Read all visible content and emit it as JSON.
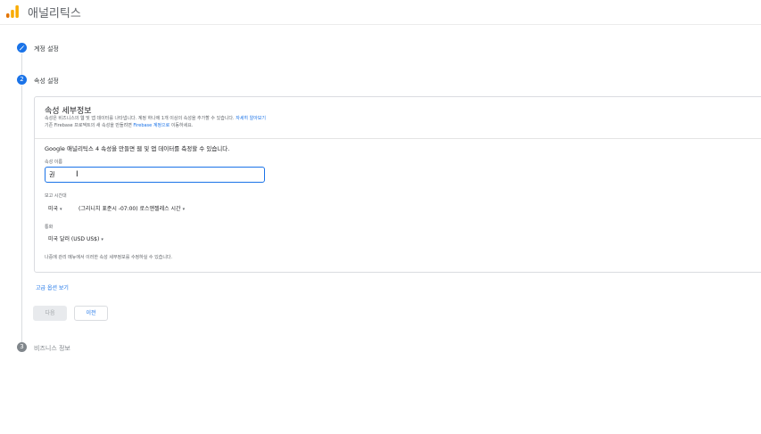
{
  "header": {
    "title": "애널리틱스"
  },
  "steps": [
    {
      "number": "1",
      "label": "계정 설정",
      "state": "done"
    },
    {
      "number": "2",
      "label": "속성 설정",
      "state": "active"
    },
    {
      "number": "3",
      "label": "비즈니스 정보",
      "state": "pending"
    }
  ],
  "card": {
    "title": "속성 세부정보",
    "desc_line1": "속성은 비즈니스의 웹 및 앱 데이터를 나타냅니다. 계정 하나에 1개 이상의 속성을 추가할 수 있습니다.",
    "desc_link1": "자세히 알아보기",
    "desc_line2_a": "기존 Firebase 프로젝트의 새 속성을 만들려면",
    "desc_link2": "Firebase 계정으로",
    "desc_line2_b": "이동하세요.",
    "intro": "Google 애널리틱스 4 속성을 만들면 웹 및 앱 데이터를 측정할 수 있습니다.",
    "name_label": "속성 이름",
    "name_value": "권",
    "timezone_label": "보고 시간대",
    "timezone_country": "미국",
    "timezone_value": "(그리니치 표준시 -07:00) 로스앤젤레스 시간",
    "currency_label": "통화",
    "currency_value": "미국 달러 (USD US$)",
    "note": "나중에 관리 메뉴에서 이러한 속성 세부정보를 수정하실 수 있습니다."
  },
  "advanced_link": "고급 옵션 보기",
  "buttons": {
    "next": "다음",
    "prev": "이전"
  },
  "colors": {
    "accent": "#1a73e8",
    "done_step": "#1a73e8",
    "pending_step": "#80868b",
    "logo_orange": "#f9ab00",
    "logo_dark": "#e37400"
  }
}
